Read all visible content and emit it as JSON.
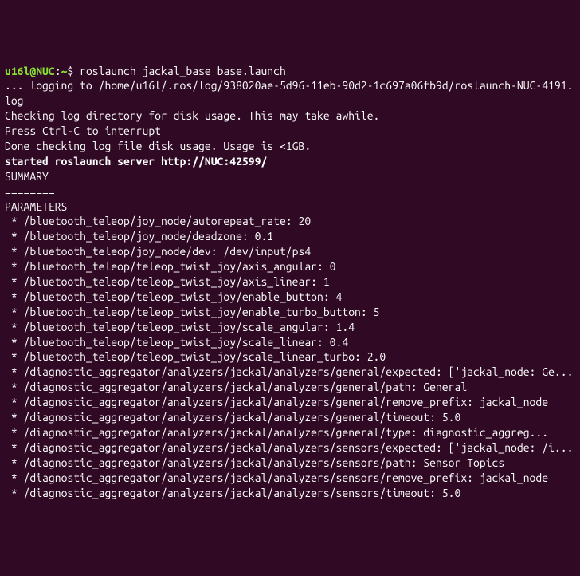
{
  "prompt": {
    "user_host": "u16l@NUC",
    "separator": ":",
    "path": "~",
    "dollar": "$ ",
    "command": "roslaunch jackal_base base.launch"
  },
  "lines": {
    "logging": "... logging to /home/u16l/.ros/log/938020ae-5d96-11eb-90d2-1c697a06fb9d/roslaunch-NUC-4191.log",
    "checking": "Checking log directory for disk usage. This may take awhile.",
    "ctrlc": "Press Ctrl-C to interrupt",
    "done": "Done checking log file disk usage. Usage is <1GB.",
    "blank1": "",
    "started": "started roslaunch server http://NUC:42599/",
    "blank2": "",
    "summary": "SUMMARY",
    "divider": "========",
    "blank3": "",
    "parameters": "PARAMETERS",
    "p1": " * /bluetooth_teleop/joy_node/autorepeat_rate: 20",
    "p2": " * /bluetooth_teleop/joy_node/deadzone: 0.1",
    "p3": " * /bluetooth_teleop/joy_node/dev: /dev/input/ps4",
    "p4": " * /bluetooth_teleop/teleop_twist_joy/axis_angular: 0",
    "p5": " * /bluetooth_teleop/teleop_twist_joy/axis_linear: 1",
    "p6": " * /bluetooth_teleop/teleop_twist_joy/enable_button: 4",
    "p7": " * /bluetooth_teleop/teleop_twist_joy/enable_turbo_button: 5",
    "p8": " * /bluetooth_teleop/teleop_twist_joy/scale_angular: 1.4",
    "p9": " * /bluetooth_teleop/teleop_twist_joy/scale_linear: 0.4",
    "p10": " * /bluetooth_teleop/teleop_twist_joy/scale_linear_turbo: 2.0",
    "p11": " * /diagnostic_aggregator/analyzers/jackal/analyzers/general/expected: ['jackal_node: Ge...",
    "p12": " * /diagnostic_aggregator/analyzers/jackal/analyzers/general/path: General",
    "p13": " * /diagnostic_aggregator/analyzers/jackal/analyzers/general/remove_prefix: jackal_node",
    "p14": " * /diagnostic_aggregator/analyzers/jackal/analyzers/general/timeout: 5.0",
    "p15": " * /diagnostic_aggregator/analyzers/jackal/analyzers/general/type: diagnostic_aggreg...",
    "p16": " * /diagnostic_aggregator/analyzers/jackal/analyzers/sensors/expected: ['jackal_node: /i...",
    "p17": " * /diagnostic_aggregator/analyzers/jackal/analyzers/sensors/path: Sensor Topics",
    "p18": " * /diagnostic_aggregator/analyzers/jackal/analyzers/sensors/remove_prefix: jackal_node",
    "p19": " * /diagnostic_aggregator/analyzers/jackal/analyzers/sensors/timeout: 5.0"
  }
}
